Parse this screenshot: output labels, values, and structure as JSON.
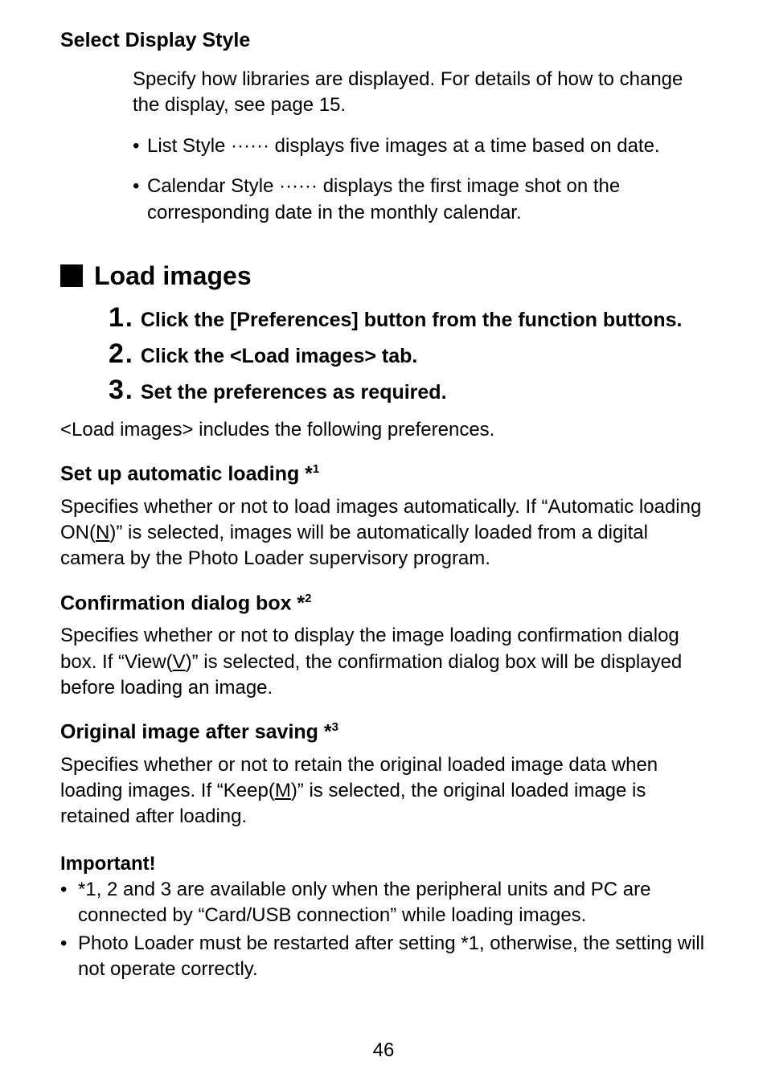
{
  "selectDisplay": {
    "heading": "Select Display Style",
    "intro": "Specify how libraries are displayed. For details of how to change the display, see page 15.",
    "bullets": [
      "List Style ······ displays five images at a time based on date.",
      "Calendar Style ······ displays the first image shot on the corresponding date in the monthly calendar."
    ]
  },
  "loadImages": {
    "heading": "Load images",
    "steps": [
      "Click the [Preferences] button from the function buttons.",
      "Click the <Load images> tab.",
      "Set the preferences as required."
    ],
    "afterSteps": "<Load images> includes the following preferences.",
    "autoLoading": {
      "heading_pre": "Set up automatic loading *",
      "heading_sup": "1",
      "body_pre": "Specifies whether or not to load images automatically. If “Automatic loading ON(",
      "body_u": "N",
      "body_post": ")” is selected, images will be automatically loaded from a digital camera by the Photo Loader supervisory program."
    },
    "confirmBox": {
      "heading_pre": "Confirmation dialog box *",
      "heading_sup": "2",
      "body_pre": "Specifies whether or not to display the image loading confirmation dialog box. If “View(",
      "body_u": "V",
      "body_post": ")” is selected, the confirmation dialog box will be displayed before loading an image."
    },
    "origImage": {
      "heading_pre": "Original image after saving *",
      "heading_sup": "3",
      "body_pre": "Specifies whether or not to retain the original loaded image data when loading images. If “Keep(",
      "body_u": "M",
      "body_post": ")” is selected, the original loaded image is retained after loading."
    },
    "important": {
      "label": "Important!",
      "items": [
        "*1, 2 and 3 are available only when the peripheral units and PC are connected by “Card/USB connection” while loading images.",
        "Photo Loader must be restarted after setting *1, otherwise, the setting will not operate correctly."
      ]
    }
  },
  "pageNumber": "46"
}
